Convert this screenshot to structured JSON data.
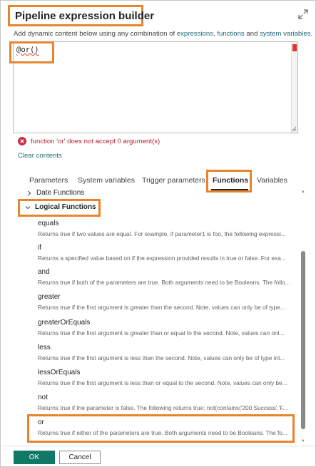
{
  "dialog": {
    "title": "Pipeline expression builder",
    "help": {
      "prefix": "Add dynamic content below using any combination of ",
      "link_expressions": "expressions,",
      "link_functions": "functions",
      "and_text": " and ",
      "link_system_variables": "system variables."
    },
    "editor": {
      "value": "@or()"
    },
    "error": {
      "message": "function 'or' does not accept 0 argument(s)"
    },
    "clear_contents": "Clear contents"
  },
  "tabs": [
    "Parameters",
    "System variables",
    "Trigger parameters",
    "Functions",
    "Variables"
  ],
  "active_tab": "Functions",
  "sections": {
    "date": "Date Functions",
    "logical": "Logical Functions"
  },
  "functions": [
    {
      "name": "equals",
      "desc": "Returns true if two values are equal. For example, if parameter1 is foo, the following expressi..."
    },
    {
      "name": "if",
      "desc": "Returns a specified value based on if the expression provided results in true or false. For exa..."
    },
    {
      "name": "and",
      "desc": "Returns true if both of the parameters are true. Both arguments need to be Booleans. The follo..."
    },
    {
      "name": "greater",
      "desc": "Returns true if the first argument is greater than the second. Note, values can only be of type..."
    },
    {
      "name": "greaterOrEquals",
      "desc": "Returns true if the first argument is greater than or equal to the second. Note, values can onl..."
    },
    {
      "name": "less",
      "desc": "Returns true if the first argument is less than the second. Note, values can only be of type int..."
    },
    {
      "name": "lessOrEquals",
      "desc": "Returns true if the first argument is less than or equal to the second. Note, values can only be..."
    },
    {
      "name": "not",
      "desc": "Returns true if the parameter is false. The following returns true: not(contains('200 Success','F..."
    },
    {
      "name": "or",
      "desc": "Returns true if either of the parameters are true. Both arguments need to be Booleans. The fo..."
    }
  ],
  "buttons": {
    "ok": "OK",
    "cancel": "Cancel"
  },
  "colors": {
    "accent": "#117865",
    "highlight": "#e8842c",
    "error": "#b12331",
    "link": "#1f6b77"
  }
}
